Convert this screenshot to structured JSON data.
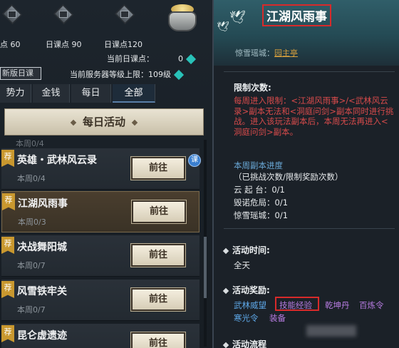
{
  "top": {
    "points": [
      {
        "label": "点 60"
      },
      {
        "label": "日课点 90"
      },
      {
        "label": "日课点120"
      }
    ],
    "current_daily_label": "当前日课点：",
    "current_daily_value": "0",
    "server_cap_label": "当前服务器等级上限：",
    "server_cap_value": "109级",
    "new_daily_button": "新版日课"
  },
  "tabs": [
    {
      "label": "势力"
    },
    {
      "label": "金钱"
    },
    {
      "label": "每日"
    },
    {
      "label": "全部",
      "active": true
    }
  ],
  "section_header": "每日活动",
  "ghost_row_sub": "本周0/4",
  "activities": [
    {
      "tag": "荐",
      "title": "英雄・武林风云录",
      "progress": "本周0/4",
      "button": "前往",
      "badge": "课"
    },
    {
      "tag": "荐",
      "title": "江湖风雨事",
      "progress": "本周0/3",
      "button": "前往",
      "selected": true
    },
    {
      "tag": "荐",
      "title": "决战舞阳城",
      "progress": "本周0/7",
      "button": "前往"
    },
    {
      "tag": "荐",
      "title": "风雪铁牢关",
      "progress": "本周0/7",
      "button": "前往"
    },
    {
      "tag": "荐",
      "title": "昆仑虚遗迹",
      "progress": "",
      "button": "前往"
    }
  ],
  "detail": {
    "title": "江湖风雨事",
    "location_label": "惊雪瑶城：",
    "location_value": "园主亭",
    "limit_heading": "限制次数:",
    "limit_text": "每周进入限制：<江湖风雨事>/<武林风云录>副本无法和<洞庭问剑>副本同时进行挑战。进入该玩法副本后，本周无法再进入<洞庭问剑>副本。",
    "progress_title": "本周副本进度",
    "progress_note": "（已挑战次数/限制奖励次数）",
    "stages": [
      {
        "name": "云 起 台：",
        "value": "0/1"
      },
      {
        "name": "毁诺危局：",
        "value": "0/1"
      },
      {
        "name": "惊雪瑶城：",
        "value": "0/1"
      }
    ],
    "time_heading": "活动时间:",
    "time_value": "全天",
    "reward_heading": "活动奖励:",
    "rewards_line1": [
      "武林威望",
      "技能经验",
      "乾坤丹",
      "百炼令"
    ],
    "rewards_line2": [
      "寒光令",
      "装备"
    ],
    "next_heading": "活动流程"
  },
  "colors": {
    "red_text": "#d84b4b",
    "blue_text": "#6aa9d8",
    "gold_link": "#d7a03d",
    "highlight_box": "#d82a2a",
    "purple_reward": "#b67be0",
    "blue_reward": "#5ea8e8"
  }
}
